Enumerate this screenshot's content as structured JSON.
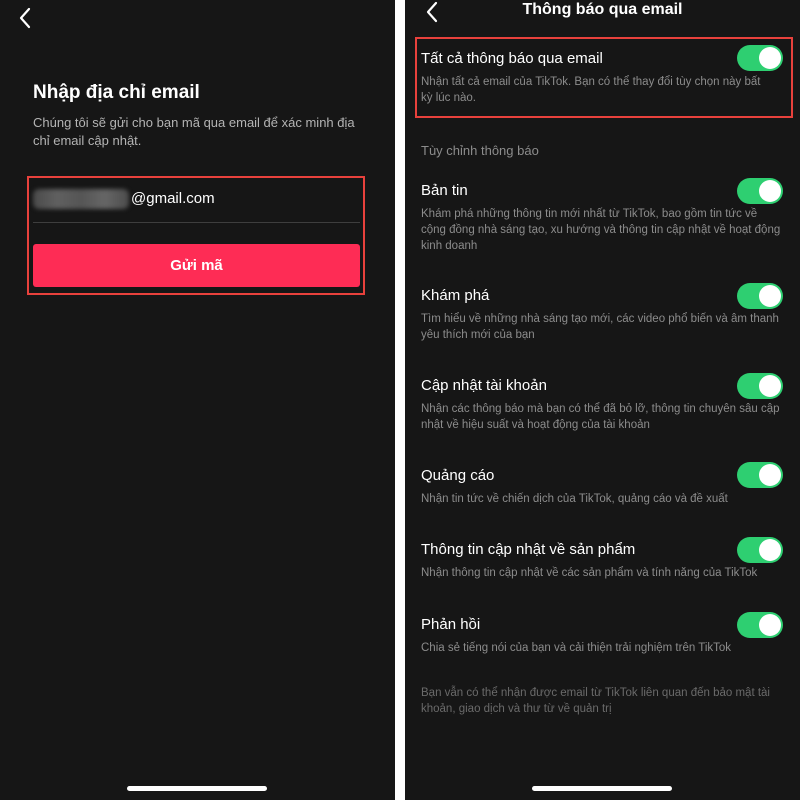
{
  "left_screen": {
    "title": "Nhập địa chỉ email",
    "description": "Chúng tôi sẽ gửi cho bạn mã qua email để xác minh địa chỉ email cập nhật.",
    "email_suffix": "@gmail.com",
    "send_button_label": "Gửi mã",
    "icons": {
      "back": "chevron-left-icon"
    },
    "colors": {
      "button": "#fe2c55",
      "highlight": "#e8413c",
      "background": "#161616"
    }
  },
  "right_screen": {
    "header_title": "Thông báo qua email",
    "master_setting": {
      "title": "Tất cả thông báo qua email",
      "description": "Nhận tất cả email của TikTok. Bạn có thể thay đổi tùy chọn này bất kỳ lúc nào.",
      "enabled": true
    },
    "section_label": "Tùy chỉnh thông báo",
    "settings": [
      {
        "title": "Bản tin",
        "description": "Khám phá những thông tin mới nhất từ TikTok, bao gồm tin tức về cộng đồng nhà sáng tạo, xu hướng và thông tin cập nhật về hoạt động kinh doanh",
        "enabled": true
      },
      {
        "title": "Khám phá",
        "description": "Tìm hiểu về những nhà sáng tạo mới, các video phổ biến và âm thanh yêu thích mới của bạn",
        "enabled": true
      },
      {
        "title": "Cập nhật tài khoản",
        "description": "Nhận các thông báo mà bạn có thể đã bỏ lỡ, thông tin chuyên sâu cập nhật về hiệu suất và hoạt động của tài khoản",
        "enabled": true
      },
      {
        "title": "Quảng cáo",
        "description": "Nhận tin tức về chiến dịch của TikTok, quảng cáo và đề xuất",
        "enabled": true
      },
      {
        "title": "Thông tin cập nhật về sản phẩm",
        "description": "Nhận thông tin cập nhật về các sản phẩm và tính năng của TikTok",
        "enabled": true
      },
      {
        "title": "Phản hồi",
        "description": "Chia sẻ tiếng nói của bạn và cải thiện trải nghiệm trên TikTok",
        "enabled": true
      }
    ],
    "footer_note": "Bạn vẫn có thể nhận được email từ TikTok liên quan đến bảo mật tài khoản, giao dịch và thư từ về quản trị",
    "colors": {
      "toggle_on": "#2ecf71",
      "highlight": "#e8413c"
    }
  }
}
